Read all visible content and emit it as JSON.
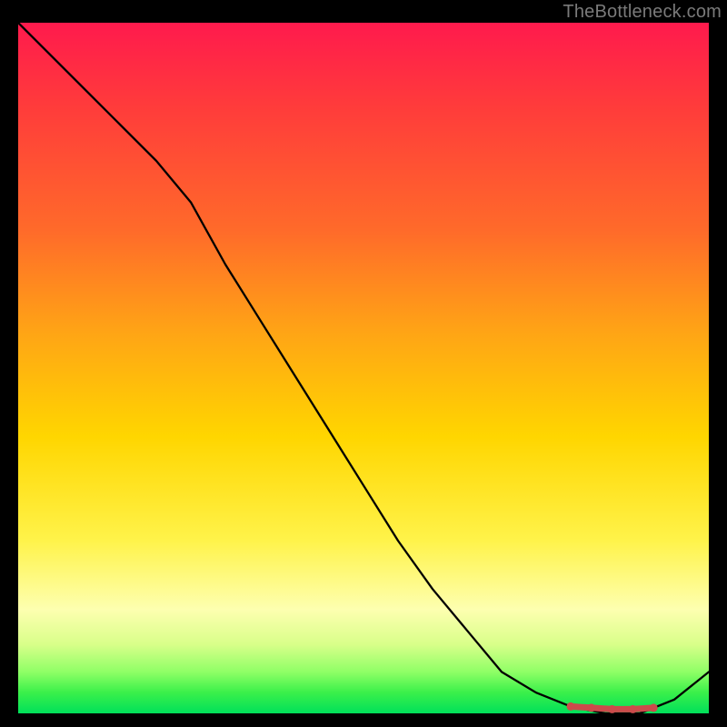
{
  "attribution": "TheBottleneck.com",
  "chart_data": {
    "type": "line",
    "x": [
      0.0,
      0.05,
      0.1,
      0.15,
      0.2,
      0.25,
      0.3,
      0.35,
      0.4,
      0.45,
      0.5,
      0.55,
      0.6,
      0.65,
      0.7,
      0.75,
      0.8,
      0.85,
      0.9,
      0.95,
      1.0
    ],
    "values": [
      100,
      95,
      90,
      85,
      80,
      74,
      65,
      57,
      49,
      41,
      33,
      25,
      18,
      12,
      6,
      3,
      1,
      0,
      0,
      2,
      6
    ],
    "title": "",
    "xlabel": "",
    "ylabel": "",
    "xlim": [
      0,
      1
    ],
    "ylim": [
      0,
      100
    ],
    "markers": {
      "x": [
        0.8,
        0.83,
        0.86,
        0.89,
        0.92
      ],
      "values": [
        1.0,
        0.8,
        0.6,
        0.6,
        0.8
      ],
      "color": "#cc4b4b"
    },
    "background_gradient": {
      "top_color": "#ff1a4d",
      "bottom_color": "#00e05a"
    }
  }
}
